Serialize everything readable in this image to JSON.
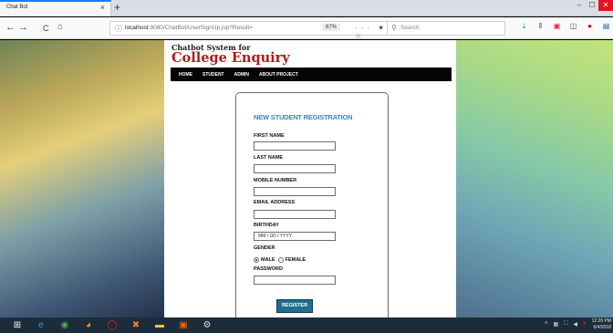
{
  "browser": {
    "tab_title": "Chat Bot",
    "tab_close": "×",
    "new_tab": "+",
    "window_buttons": [
      "–",
      "☐",
      "✕"
    ],
    "nav": {
      "back": "←",
      "forward": "→",
      "reload": "C",
      "home": "⌂"
    },
    "url_host": "localhost",
    "url_path": ":8080/ChatBot/UserSignUp.jsp?Result=",
    "zoom": "67%",
    "url_actions": "··· ♥ ☆",
    "search_placeholder": "Search"
  },
  "site": {
    "brand_line1": "Chatbot System for",
    "brand_line2": "College Enquiry",
    "menu": [
      "HOME",
      "STUDENT",
      "ADMIN",
      "ABOUT PROJECT"
    ]
  },
  "form": {
    "title": "NEW STUDENT REGISTRATION",
    "first_name_label": "FIRST NAME",
    "last_name_label": "LAST NAME",
    "mobile_label": "MOBILE NUMBER",
    "email_label": "EMAIL ADDRESS",
    "birthday_label": "BIRTHDAY",
    "birthday_placeholder": "MM / DD / YYYY",
    "gender_label": "GENDER",
    "gender_options": [
      "MALE",
      "FEMALE"
    ],
    "selected_gender": "MALE",
    "password_label": "PASSWORD",
    "register_label": "REGISTER"
  },
  "taskbar": {
    "time": "12:26 PM",
    "date": "6/4/2018"
  }
}
